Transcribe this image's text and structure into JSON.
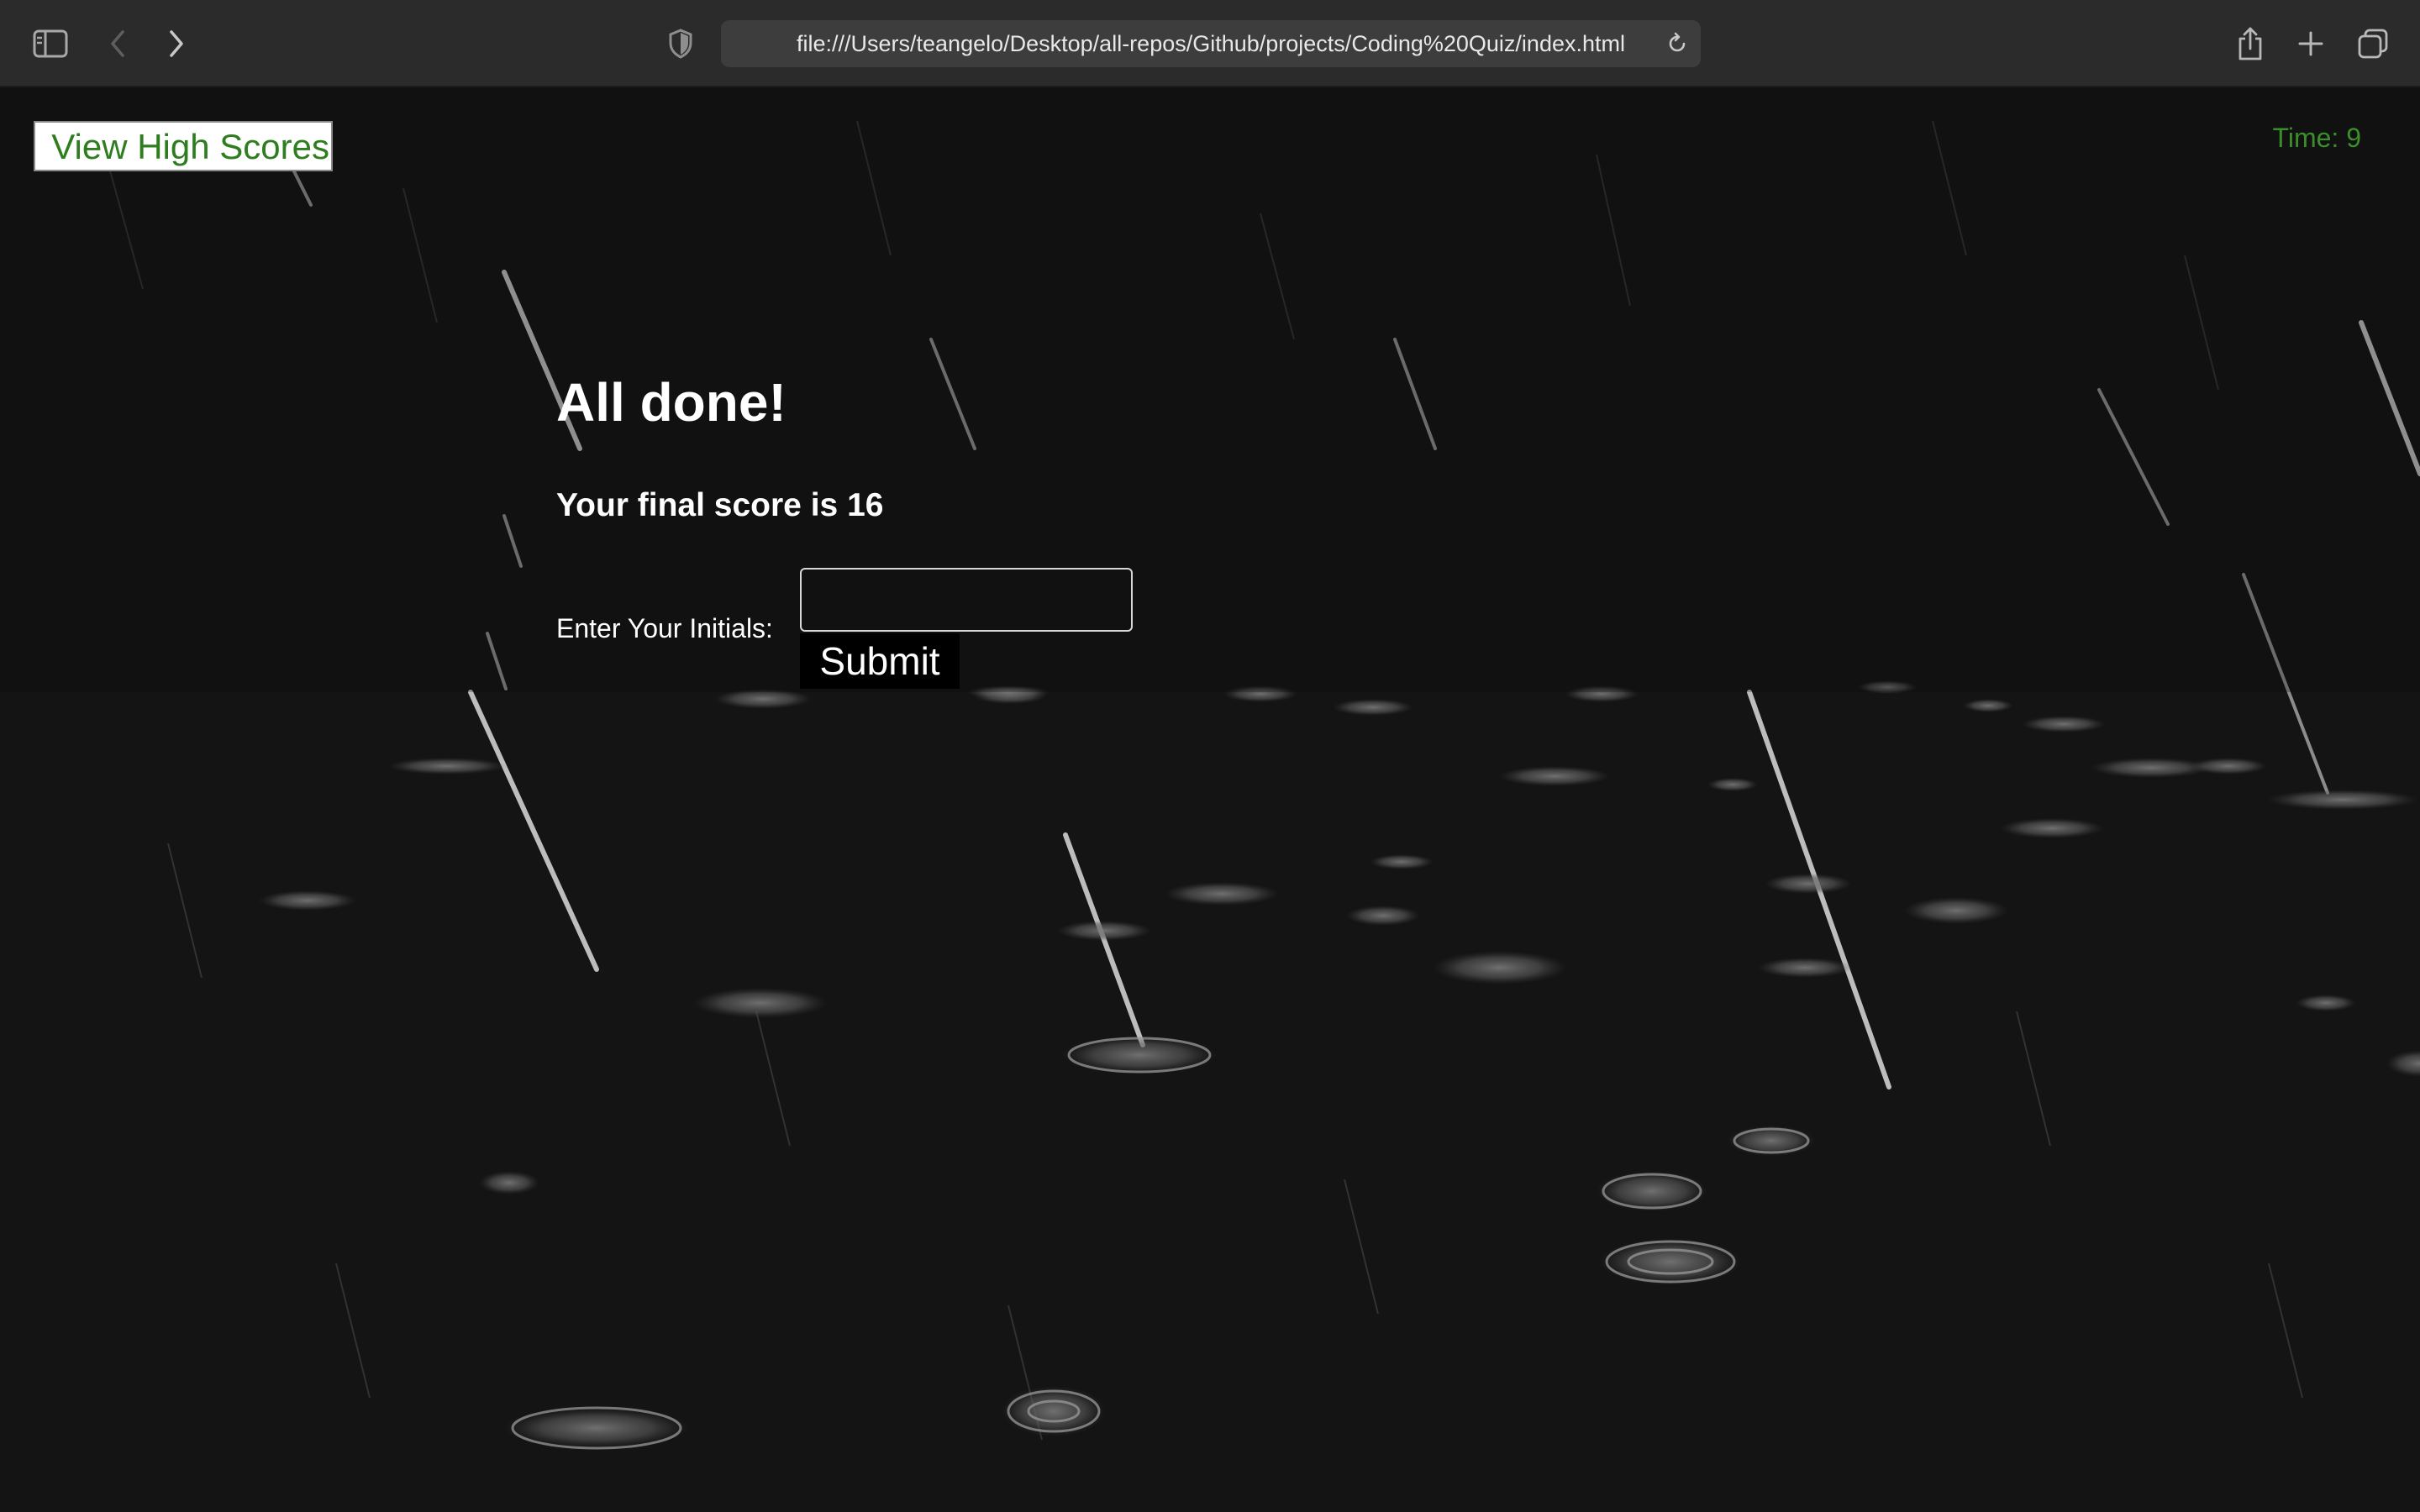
{
  "browser": {
    "url": "file:///Users/teangelo/Desktop/all-repos/Github/projects/Coding%20Quiz/index.html",
    "icons": {
      "sidebar": "sidebar-toggle-icon",
      "back": "chevron-left-icon",
      "forward": "chevron-right-icon",
      "privacy": "shield-icon",
      "reload": "reload-icon",
      "share": "share-icon",
      "new_tab": "plus-icon",
      "tabs": "tab-overview-icon"
    }
  },
  "page": {
    "high_scores_label": "View High Scores",
    "timer_text": "Time: 9",
    "title": "All done!",
    "final_score_prefix": "Your final score is",
    "final_score": "16",
    "initials_label": "Enter Your Initials:",
    "initials_value": "",
    "submit_label": "Submit"
  },
  "colors": {
    "accent_green": "#2e7d1f",
    "timer_green": "#3a8f2a",
    "background": "#131313",
    "text": "#ffffff"
  }
}
